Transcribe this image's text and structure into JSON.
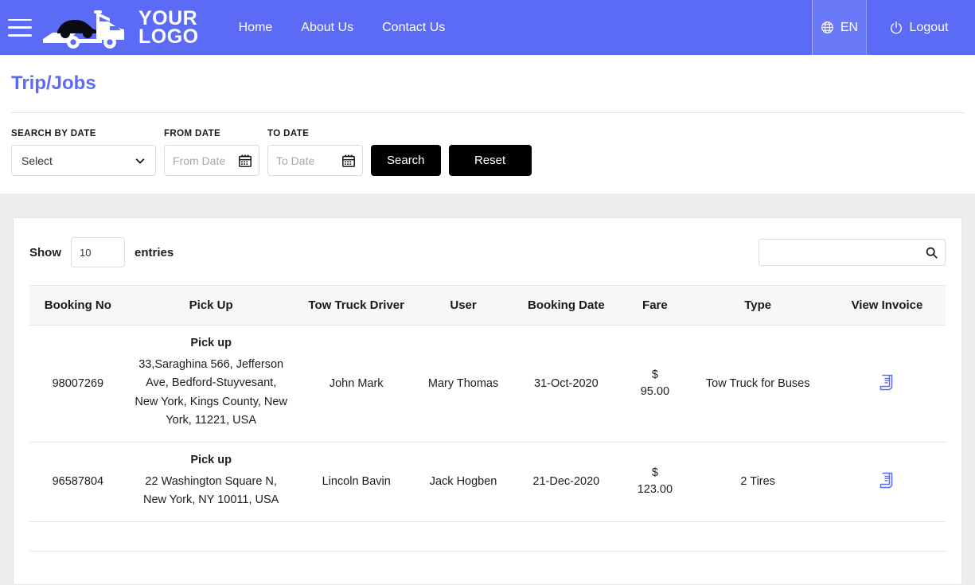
{
  "header": {
    "menu_icon": "hamburger-icon",
    "logo_line1": "YOUR",
    "logo_line2": "LOGO",
    "logo_icon": "tow-truck-logo-icon",
    "nav": [
      {
        "label": "Home"
      },
      {
        "label": "About Us"
      },
      {
        "label": "Contact Us"
      }
    ],
    "language": {
      "icon": "globe-icon",
      "label": "EN"
    },
    "logout": {
      "icon": "power-icon",
      "label": "Logout"
    },
    "brand_color": "#5b6bf5"
  },
  "page": {
    "title": "Trip/Jobs"
  },
  "filters": {
    "search_by_date": {
      "label": "SEARCH BY DATE",
      "value": "Select",
      "caret_icon": "chevron-down-icon"
    },
    "from_date": {
      "label": "FROM DATE",
      "placeholder": "From Date",
      "value": "",
      "icon": "calendar-icon"
    },
    "to_date": {
      "label": "TO DATE",
      "placeholder": "To Date",
      "value": "",
      "icon": "calendar-icon"
    },
    "search_button": "Search",
    "reset_button": "Reset"
  },
  "table_controls": {
    "show_label": "Show",
    "entries_value": "10",
    "entries_label": "entries",
    "search_placeholder": "",
    "search_value": "",
    "search_icon": "search-icon"
  },
  "table": {
    "columns": [
      "Booking No",
      "Pick Up",
      "Tow Truck Driver",
      "User",
      "Booking Date",
      "Fare",
      "Type",
      "View Invoice"
    ],
    "pickup_label": "Pick up",
    "rows": [
      {
        "booking_no": "98007269",
        "pickup_label": "Pick up",
        "pickup_address": "33,Saraghina 566, Jefferson Ave, Bedford-Stuyvesant, New York, Kings County, New York, 11221, USA",
        "driver": "John Mark",
        "user": "Mary Thomas",
        "booking_date": "31-Oct-2020",
        "fare_currency": "$",
        "fare_amount": "95.00",
        "type": "Tow Truck for Buses",
        "invoice_icon": "invoice-icon"
      },
      {
        "booking_no": "96587804",
        "pickup_label": "Pick up",
        "pickup_address": "22 Washington Square N, New York, NY 10011, USA",
        "driver": "Lincoln Bavin",
        "user": "Jack Hogben",
        "booking_date": "21-Dec-2020",
        "fare_currency": "$",
        "fare_amount": "123.00",
        "type": "2 Tires",
        "invoice_icon": "invoice-icon"
      },
      {
        "booking_no": "",
        "pickup_label": "",
        "pickup_address": "",
        "driver": "",
        "user": "",
        "booking_date": "",
        "fare_currency": "",
        "fare_amount": "",
        "type": "",
        "invoice_icon": "invoice-icon"
      }
    ]
  }
}
